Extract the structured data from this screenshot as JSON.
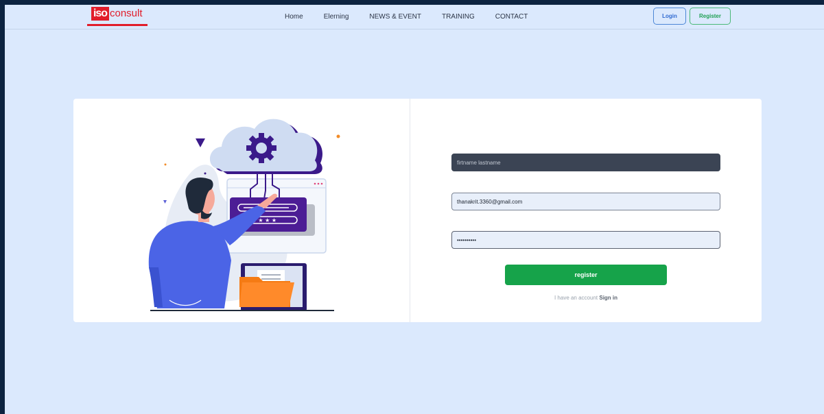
{
  "header": {
    "logo": {
      "box_text": "iso",
      "word": "consult",
      "brand_color": "#e11d2a"
    },
    "nav": [
      {
        "id": "home",
        "label": "Home"
      },
      {
        "id": "elerning",
        "label": "Elerning"
      },
      {
        "id": "news-event",
        "label": "NEWS & EVENT"
      },
      {
        "id": "training",
        "label": "TRAINING"
      },
      {
        "id": "contact",
        "label": "CONTACT"
      }
    ],
    "login_label": "Login",
    "register_label": "Register"
  },
  "form": {
    "name_placeholder": "firtname lastname",
    "name_value": "",
    "email_value": "thanakrit.3360@gmail.com",
    "password_value": "••••••••••",
    "submit_label": "register",
    "signin_prompt": "I have an account",
    "signin_link": "Sign in"
  },
  "colors": {
    "page_bg": "#dbe9fd",
    "accent_green": "#16a34a",
    "accent_blue": "#2f6ad1",
    "illustration_purple": "#4c1d95"
  }
}
